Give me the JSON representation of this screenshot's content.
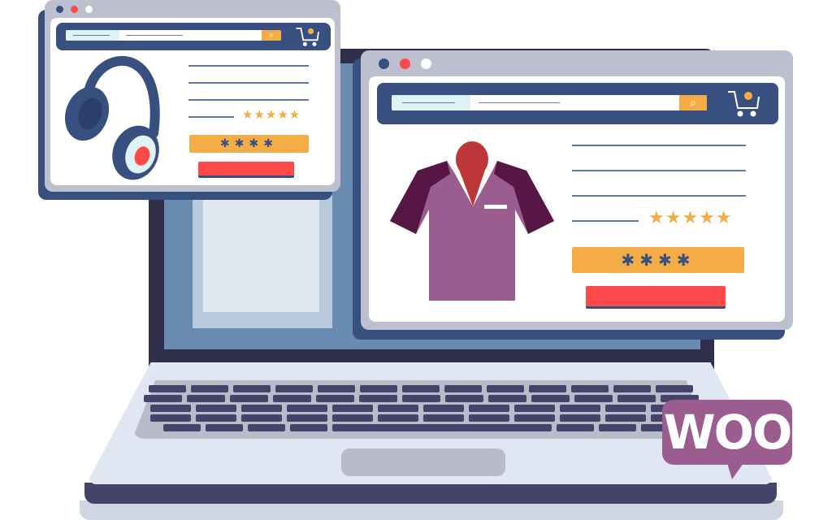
{
  "illustration": {
    "subject": "WooCommerce online store laptop illustration",
    "colors": {
      "navy": "#375080",
      "window_frame": "#bcc0cf",
      "accent_orange": "#f4ad46",
      "accent_red": "#ff4849",
      "woo_purple": "#9b5c8f",
      "shirt_purple": "#9b5c8f",
      "shirt_dark": "#561745",
      "collar_red": "#bd3638"
    }
  },
  "window_left": {
    "product": "headphones",
    "rating_stars": 5,
    "price_placeholder": "✱✱✱✱",
    "search_icon": "search-icon",
    "cart_icon": "cart-icon"
  },
  "window_right": {
    "product": "polo-shirt",
    "rating_stars": 5,
    "price_placeholder": "✱✱✱✱",
    "search_icon": "search-icon",
    "cart_icon": "cart-icon"
  },
  "badge": {
    "text": "WOO"
  },
  "glyphs": {
    "stars": "★★★★★",
    "search": "⌕"
  }
}
